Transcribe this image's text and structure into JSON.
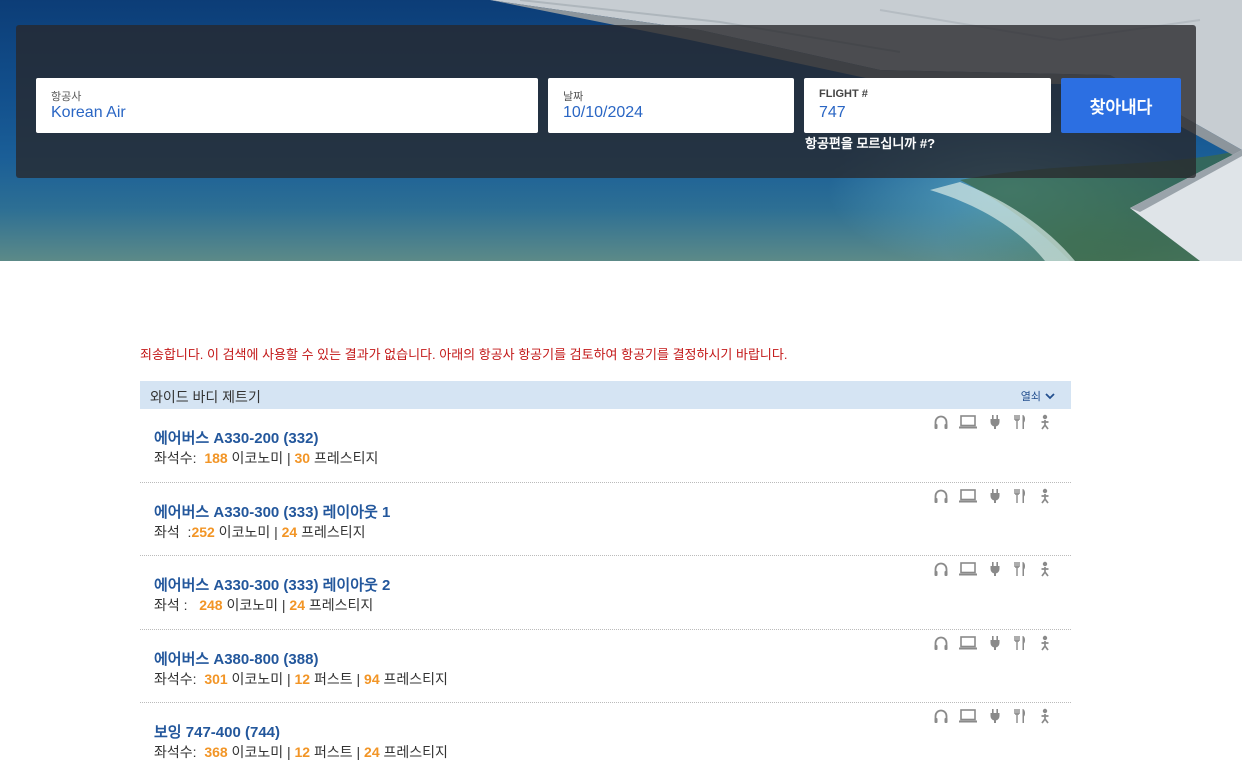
{
  "search": {
    "airline_label": "항공사",
    "airline_value": "Korean Air",
    "date_label": "날짜",
    "date_value": "10/10/2024",
    "flight_label": "FLIGHT #",
    "flight_value": "747",
    "submit_label": "찾아내다",
    "unknown_flight_link": "항공편을 모르십니까 #?"
  },
  "results": {
    "error_message": "죄송합니다. 이 검색에 사용할 수 있는 결과가 없습니다. 아래의 항공사 항공기를 검토하여 항공기를 결정하시기 바랍니다.",
    "section_title": "와이드 바디 제트기",
    "section_toggle": "열쇠",
    "aircraft": [
      {
        "name": "에어버스 A330-200 (332)",
        "seats_prefix": "좌석수:  ",
        "parts": [
          {
            "num": "188",
            "label": " 이코노미"
          },
          {
            "num": "30",
            "label": " 프레스티지"
          }
        ]
      },
      {
        "name": "에어버스 A330-300 (333) 레이아웃 1",
        "seats_prefix": "좌석  :",
        "parts": [
          {
            "num": "252",
            "label": " 이코노미"
          },
          {
            "num": "24",
            "label": " 프레스티지"
          }
        ]
      },
      {
        "name": "에어버스 A330-300 (333) 레이아웃 2",
        "seats_prefix": "좌석 :   ",
        "parts": [
          {
            "num": "248",
            "label": " 이코노미"
          },
          {
            "num": "24",
            "label": " 프레스티지"
          }
        ]
      },
      {
        "name": "에어버스 A380-800 (388)",
        "seats_prefix": "좌석수:  ",
        "parts": [
          {
            "num": "301",
            "label": " 이코노미"
          },
          {
            "num": "12",
            "label": " 퍼스트"
          },
          {
            "num": "94",
            "label": " 프레스티지"
          }
        ]
      },
      {
        "name": "보잉 747-400 (744)",
        "seats_prefix": "좌석수:  ",
        "parts": [
          {
            "num": "368",
            "label": " 이코노미"
          },
          {
            "num": "12",
            "label": " 퍼스트"
          },
          {
            "num": "24",
            "label": " 프레스티지"
          }
        ]
      }
    ],
    "amenity_icons": [
      "headphones-icon",
      "laptop-icon",
      "power-plug-icon",
      "fork-knife-icon",
      "seat-icon"
    ]
  },
  "colors": {
    "accent": "#2c6fe2",
    "link": "#23579c",
    "highlight": "#f29526",
    "error": "#c31818",
    "header_bg": "#d5e4f3"
  }
}
